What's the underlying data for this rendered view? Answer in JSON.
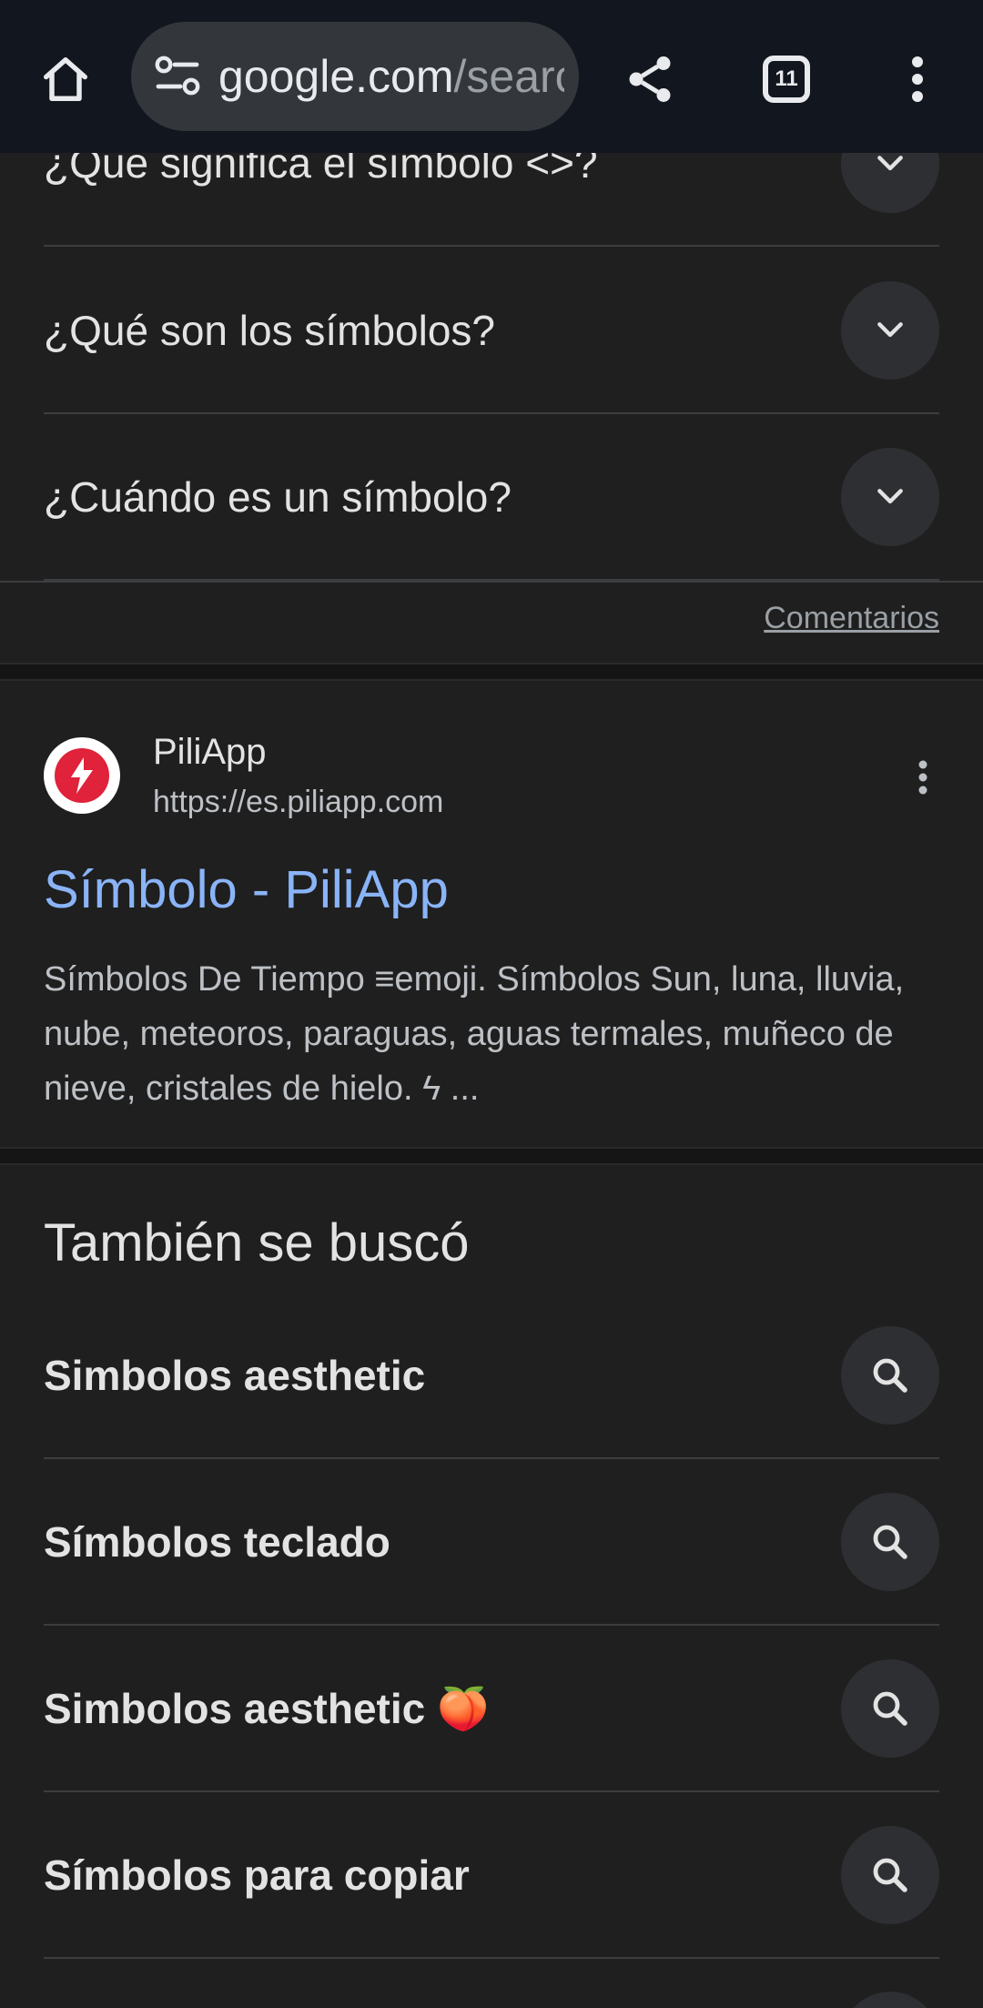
{
  "toolbar": {
    "url_host": "google.com",
    "url_path": "/searc",
    "tab_count": "11"
  },
  "faq": {
    "items": [
      {
        "question": "¿Qué significa el símbolo <>?"
      },
      {
        "question": "¿Qué son los símbolos?"
      },
      {
        "question": "¿Cuándo es un símbolo?"
      }
    ],
    "feedback_label": "Comentarios"
  },
  "result": {
    "site_name": "PiliApp",
    "site_url": "https://es.piliapp.com",
    "title": "Símbolo - PiliApp",
    "snippet": "Símbolos De Tiempo ≡emoji. Símbolos Sun, luna, lluvia, nube, meteoros, paraguas, aguas termales, muñeco de nieve, cristales de hielo. ϟ ..."
  },
  "related": {
    "heading": "También se buscó",
    "items": [
      {
        "label": "Simbolos aesthetic"
      },
      {
        "label": "Símbolos teclado"
      },
      {
        "label": "Simbolos aesthetic 🍑"
      },
      {
        "label": "Símbolos para copiar"
      }
    ]
  },
  "colors": {
    "background": "#1f1f1f",
    "toolbar": "#12161e",
    "link": "#8ab4f8",
    "favicon_red": "#e0223a"
  }
}
